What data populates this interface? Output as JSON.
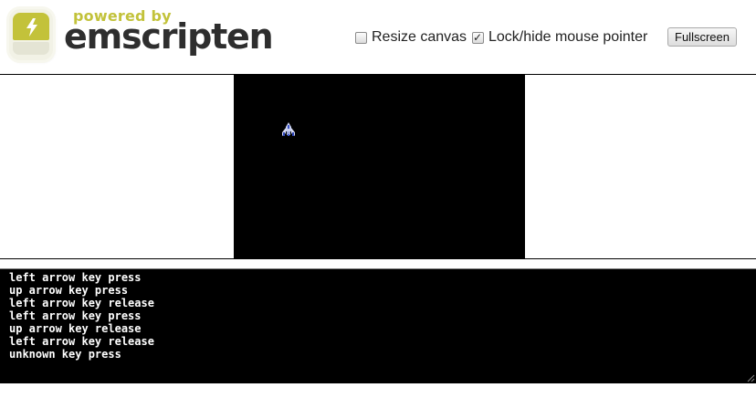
{
  "header": {
    "logo": {
      "powered_by": "powered by",
      "name": "emscripten"
    },
    "resize_canvas": {
      "label": "Resize canvas",
      "checked": false
    },
    "lock_pointer": {
      "label": "Lock/hide mouse pointer",
      "checked": true
    },
    "fullscreen_label": "Fullscreen"
  },
  "canvas": {
    "background": "#000000",
    "sprite_icon": "ship-sprite-icon"
  },
  "output": {
    "lines": [
      "left arrow key press",
      "up arrow key press",
      "left arrow key release",
      "left arrow key press",
      "up arrow key release",
      "left arrow key release",
      "unknown key press"
    ]
  },
  "colors": {
    "logo_accent": "#c2c23a",
    "logo_text": "#2e2e2e",
    "console_bg": "#000000",
    "console_text": "#ffffff"
  }
}
